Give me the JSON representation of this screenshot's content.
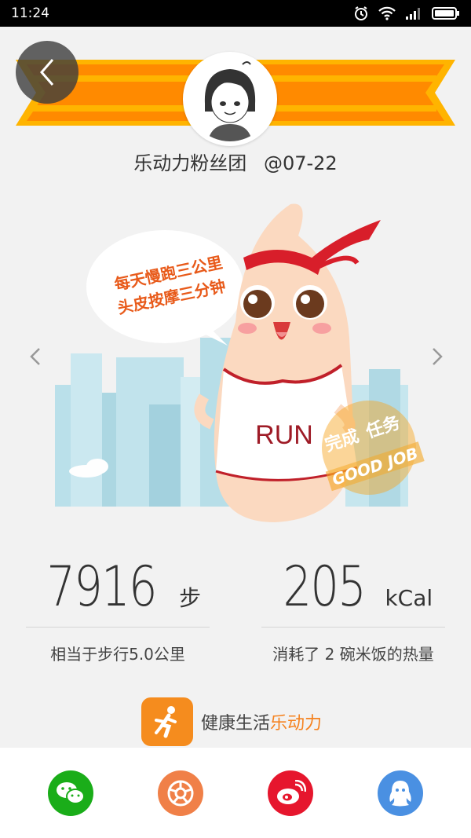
{
  "status_bar": {
    "time": "11:24"
  },
  "header": {
    "username": "乐动力粉丝团",
    "date": "@07-22"
  },
  "illustration": {
    "speech_line1": "每天慢跑三公里",
    "speech_line2": "头皮按摩三分钟",
    "shirt_text": "RUN",
    "stamp_line1": "完成",
    "stamp_line2": "任务",
    "stamp_line3": "GOOD JOB"
  },
  "stats": {
    "steps": {
      "value": "7916",
      "unit": "步",
      "desc": "相当于步行5.0公里"
    },
    "calories": {
      "value": "205",
      "unit": "kCal",
      "desc": "消耗了 2 碗米饭的热量"
    }
  },
  "brand": {
    "text_plain": "健康生活",
    "text_highlight": "乐动力"
  },
  "share": [
    {
      "icon": "wechat-icon",
      "color": "#1aad19"
    },
    {
      "icon": "moments-icon",
      "color": "#f08048"
    },
    {
      "icon": "weibo-icon",
      "color": "#e6162d"
    },
    {
      "icon": "qq-icon",
      "color": "#4a90e2"
    }
  ],
  "colors": {
    "accent": "#f5821f",
    "banner_orange": "#ff8a00",
    "banner_yellow": "#ffb400"
  }
}
